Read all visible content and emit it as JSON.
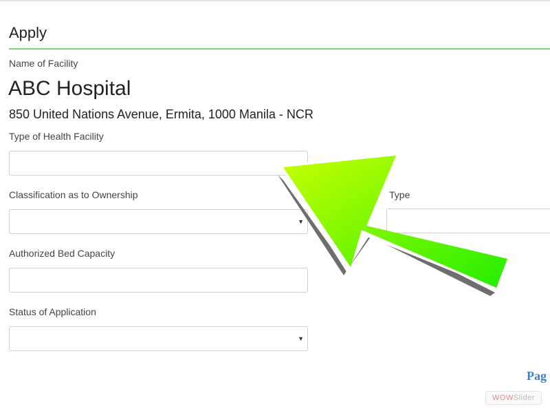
{
  "header": {
    "title": "Apply"
  },
  "facility": {
    "name_label": "Name of Facility",
    "name": "ABC Hospital",
    "address": "850 United Nations Avenue, Ermita, 1000 Manila - NCR"
  },
  "form": {
    "type_label": "Type of Health Facility",
    "type_value": "",
    "ownership_label": "Classification as to Ownership",
    "ownership_value": "",
    "right_type_label": "Type",
    "bed_label": "Authorized Bed Capacity",
    "bed_value": "",
    "status_label": "Status of Application",
    "status_value": "",
    "select_caret": "▼"
  },
  "footer": {
    "page_link": "Pag"
  },
  "watermark": {
    "part1": "WOW",
    "part2": "Slider"
  },
  "colors": {
    "accent_line": "#7bd47b",
    "arrow_fill": "#33ee00",
    "link": "#3f7fc4"
  },
  "annotation": {
    "icon": "green-pointer-arrow"
  }
}
